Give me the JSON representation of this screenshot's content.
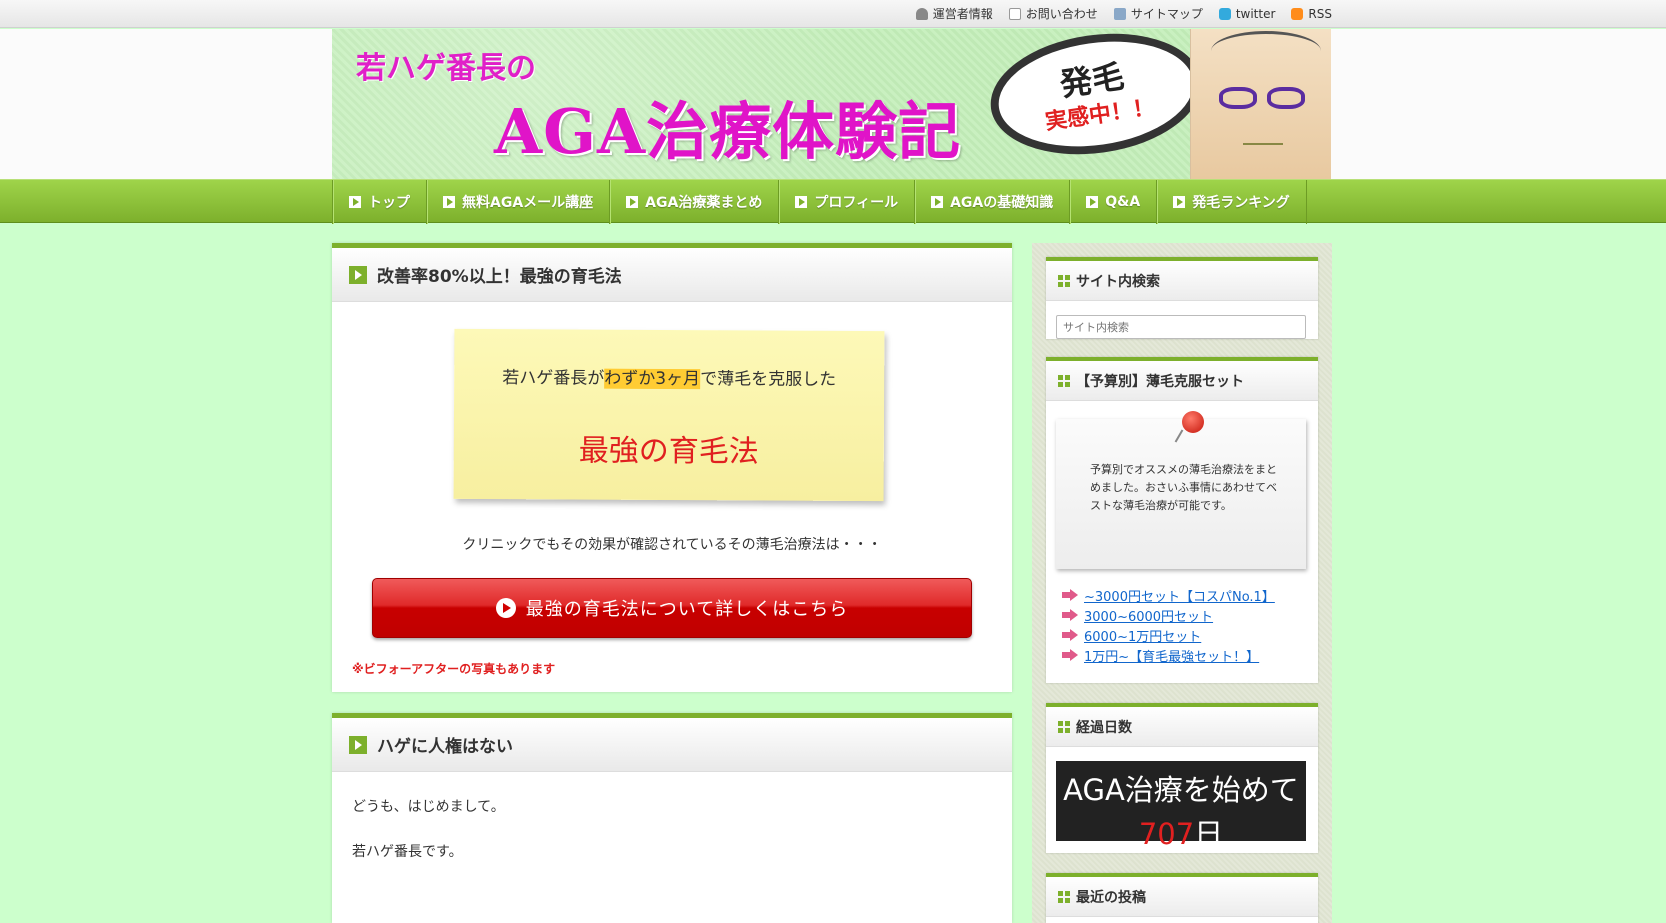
{
  "topbar": {
    "links": [
      {
        "label": "運営者情報",
        "icon": "person-icon"
      },
      {
        "label": "お問い合わせ",
        "icon": "mail-icon"
      },
      {
        "label": "サイトマップ",
        "icon": "sitemap-icon"
      },
      {
        "label": "twitter",
        "icon": "twitter-icon"
      },
      {
        "label": "RSS",
        "icon": "rss-icon"
      }
    ]
  },
  "banner": {
    "subtitle": "若ハゲ番長の",
    "title": "AGA治療体験記",
    "bubble_main": "発毛",
    "bubble_sub": "実感中！！"
  },
  "nav": {
    "items": [
      {
        "label": "トップ"
      },
      {
        "label": "無料AGAメール講座"
      },
      {
        "label": "AGA治療薬まとめ"
      },
      {
        "label": "プロフィール"
      },
      {
        "label": "AGAの基礎知識"
      },
      {
        "label": "Q&A"
      },
      {
        "label": "発毛ランキング"
      }
    ]
  },
  "post1": {
    "title": "改善率80%以上！最強の育毛法",
    "note_pre": "若ハゲ番長が",
    "note_highlight": "わずか3ヶ月",
    "note_post": "で薄毛を克服した",
    "note_big": "最強の育毛法",
    "lead": "クリニックでもその効果が確認されているその薄毛治療法は・・・",
    "cta": "最強の育毛法について詳しくはこちら",
    "note_red": "※ビフォーアフターの写真もあります"
  },
  "post2": {
    "title": "ハゲに人権はない",
    "p1": "どうも、はじめまして。",
    "p2": "若ハゲ番長です。"
  },
  "sidebar": {
    "search": {
      "title": "サイト内検索",
      "placeholder": "サイト内検索"
    },
    "budget": {
      "title": "【予算別】薄毛克服セット",
      "memo": "予算別でオススメの薄毛治療法をまとめました。おさいふ事情にあわせてベストな薄毛治療が可能です。",
      "links": [
        "~3000円セット【コスパNo.1】",
        "3000~6000円セット",
        "6000~1万円セット",
        "1万円~【育毛最強セット！】"
      ]
    },
    "days": {
      "title": "経過日数",
      "line1": "AGA治療を始めて",
      "count": "707",
      "unit": "日"
    },
    "recent": {
      "title": "最近の投稿"
    }
  },
  "colors": {
    "background": "#ccffcc",
    "accent_green": "#7db02c",
    "banner_pink": "#e014c8",
    "cta_red": "#c80000",
    "link_blue": "#1166cc"
  }
}
